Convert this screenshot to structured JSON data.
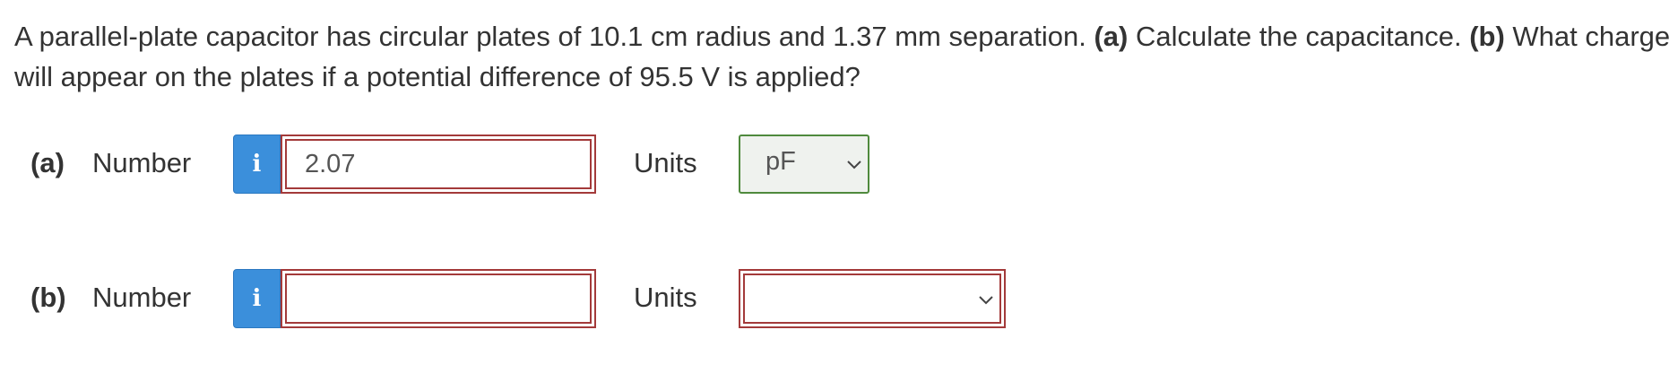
{
  "question": {
    "text_1": "A parallel-plate capacitor has circular plates of 10.1 cm radius and 1.37 mm separation. ",
    "part_a_marker": "(a)",
    "text_2": " Calculate the capacitance. ",
    "part_b_marker": "(b)",
    "text_3": " What charge will appear on the plates if a potential difference of 95.5 V is applied?"
  },
  "parts": [
    {
      "label": "(a)",
      "number_label": "Number",
      "info_icon_glyph": "i",
      "number_value": "2.07",
      "units_label": "Units",
      "units_value": "pF",
      "units_state": "correct"
    },
    {
      "label": "(b)",
      "number_label": "Number",
      "info_icon_glyph": "i",
      "number_value": "",
      "units_label": "Units",
      "units_value": "",
      "units_state": "incorrect"
    }
  ],
  "colors": {
    "info_button": "#3b8fdb",
    "error_border": "#a33a3a",
    "correct_border": "#4f8a3d"
  }
}
